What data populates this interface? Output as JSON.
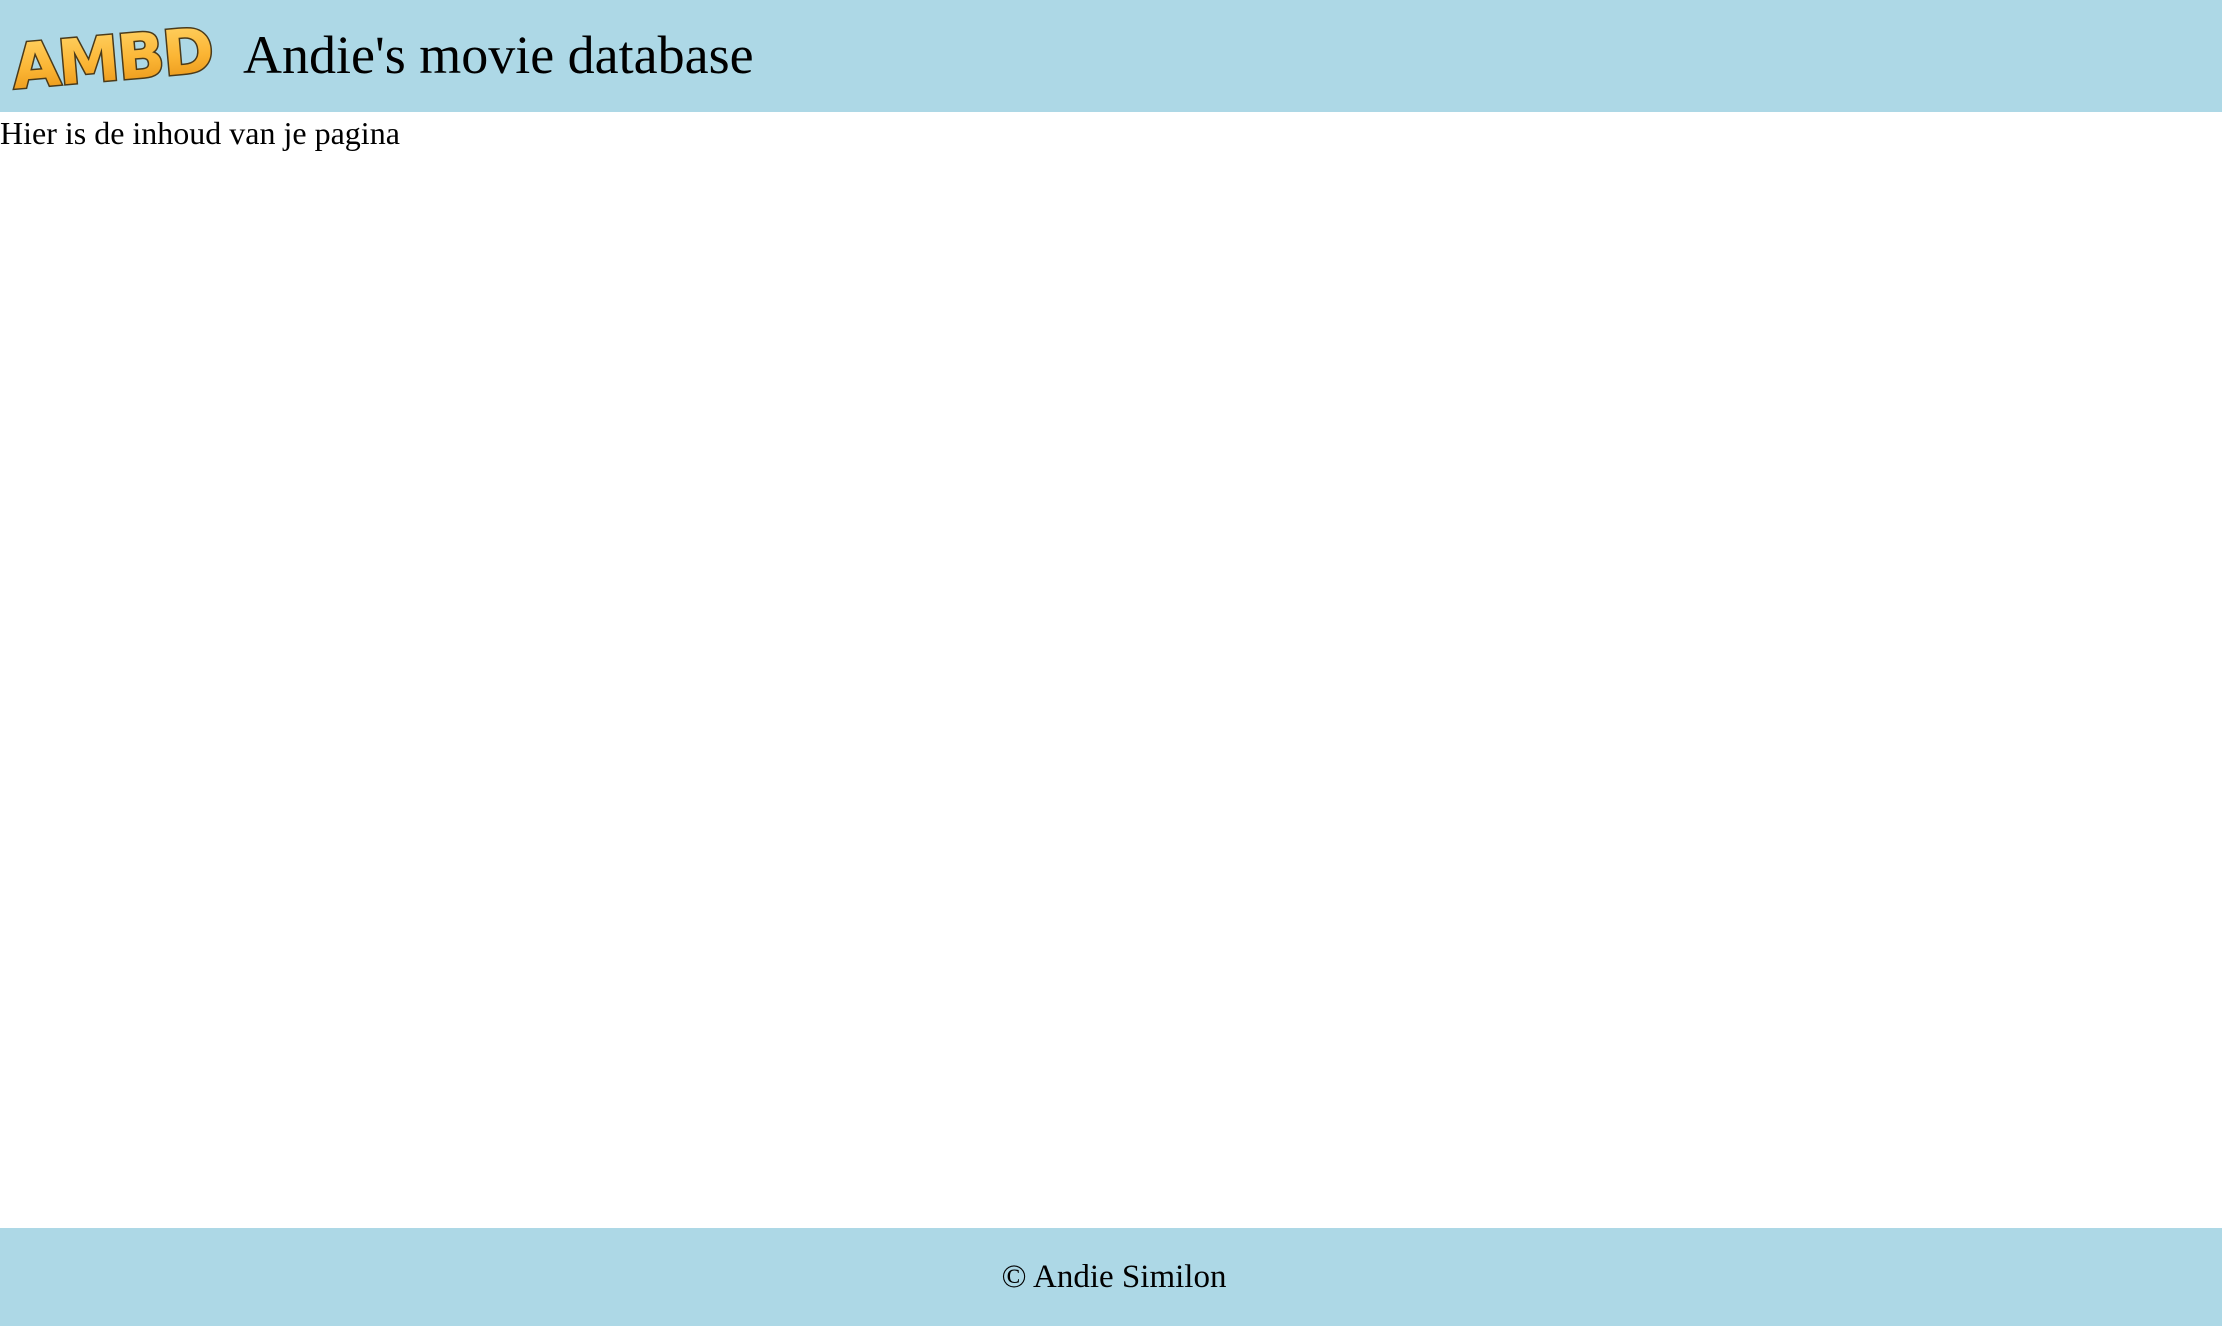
{
  "header": {
    "logo_text": "AMBD",
    "title": "Andie's movie database"
  },
  "main": {
    "content_text": "Hier is de inhoud van je pagina"
  },
  "footer": {
    "copyright": "© Andie Similon"
  },
  "colors": {
    "header_background": "#add8e6",
    "footer_background": "#add8e6",
    "page_background": "#ffffff",
    "logo_fill": "#fbb534",
    "logo_outline": "#4a3a1a"
  }
}
